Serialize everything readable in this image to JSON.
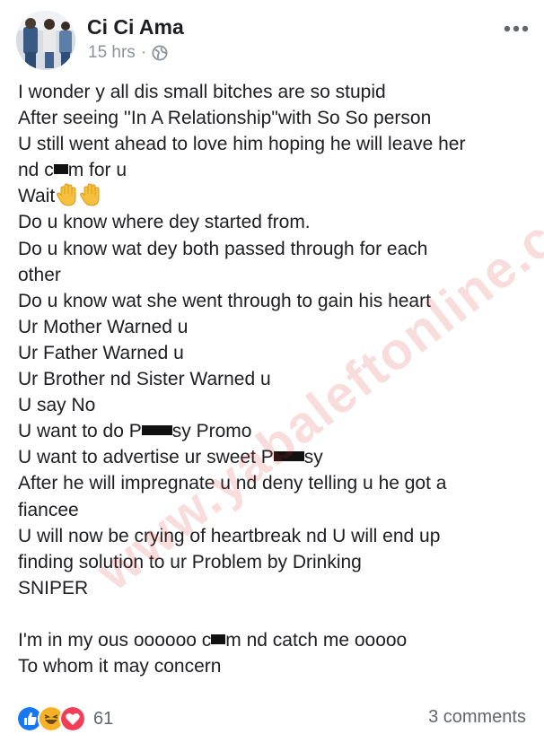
{
  "post": {
    "author": "Ci Ci Ama",
    "time": "15 hrs",
    "privacy_icon": "globe-icon",
    "watermark": "www.yabaleftonline.com",
    "lines": [
      "I wonder y all dis small bitches are so stupid",
      "After seeing ''In A Relationship\"with So So person",
      "U still went ahead to love him hoping he will leave her",
      "nd c",
      "m for u",
      "Wait",
      "Do u know where dey started from.",
      "Do u know wat dey both passed through for each",
      "other",
      "Do u know wat she went through to gain his heart",
      "Ur Mother Warned u",
      "Ur Father Warned u",
      "Ur Brother nd Sister Warned u",
      "U say No",
      "U want to do P",
      "sy Promo",
      "U want to advertise ur sweet P",
      "sy",
      "After he will impregnate u nd deny telling u he got a",
      "fiancee",
      "U will now be crying of heartbreak nd U will end up",
      "finding solution to ur Problem by Drinking",
      "SNIPER",
      "I'm in my ous oooooo c",
      "m nd catch me ooooo",
      "To whom it may concern"
    ]
  },
  "reactions": {
    "icons": [
      "like-icon",
      "haha-icon",
      "love-icon"
    ],
    "count": "61",
    "comments": "3 comments",
    "colors": {
      "like": "#1877f2",
      "haha": "#f7b125",
      "love": "#f33e58"
    }
  }
}
